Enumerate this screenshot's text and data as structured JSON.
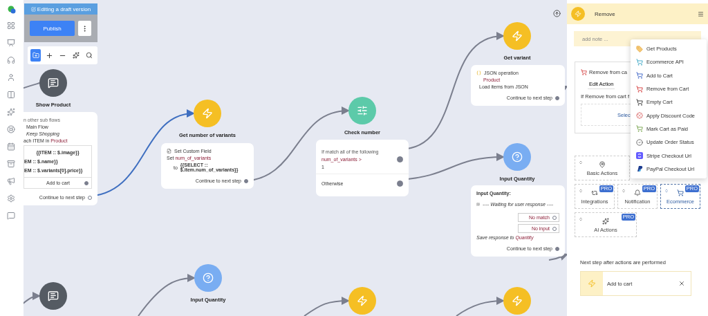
{
  "editor": {
    "banner": "Editing a draft version",
    "publish": "Publish"
  },
  "nodes": [
    {
      "kind": "message",
      "label": "Show Product",
      "card": [
        {
          "kind": "note",
          "text": "n other sub flows"
        },
        {
          "kind": "item",
          "text": "Main Flow"
        },
        {
          "kind": "item_italic",
          "text": "Keep Shopping"
        },
        {
          "kind": "field",
          "prefix": "ach ITEM in",
          "var": "Product"
        },
        {
          "kind": "gallery",
          "image": "{{ITEM :: $.image}}",
          "lines": [
            "EM :: $.name}}",
            "EM :: $.variants[0].price}}"
          ],
          "button": "Add to cart",
          "connected": true
        },
        {
          "kind": "continue",
          "text": "Continue to next step",
          "connected": false
        }
      ]
    },
    {
      "kind": "action",
      "label": "Get number of variants",
      "card": [
        {
          "kind": "custom_field",
          "text": "Set Custom Field"
        },
        {
          "kind": "field",
          "prefix": "Set",
          "var": "num_of_variants"
        },
        {
          "kind": "assign",
          "prefix": "to",
          "lines": [
            "{{SELECT ::",
            "$.item.num_of_variants}}"
          ]
        },
        {
          "kind": "continue",
          "text": "Continue to next step",
          "connected": true
        }
      ]
    },
    {
      "kind": "condition",
      "label": "Check number",
      "card": [
        {
          "kind": "condition",
          "note": "If match all of the following",
          "var": "num_of_variants >",
          "value": "1",
          "connected": true
        },
        {
          "kind": "otherwise",
          "text": "Otherwise",
          "connected": true
        }
      ]
    },
    {
      "kind": "action",
      "label": "Get variant",
      "card": [
        {
          "kind": "json_op",
          "text": "JSON operation"
        },
        {
          "kind": "var",
          "text": "Product"
        },
        {
          "kind": "item",
          "text": "Load items from JSON"
        },
        {
          "kind": "continue",
          "text": "Continue to next step",
          "connected": true
        }
      ]
    },
    {
      "kind": "question",
      "label": "Input Quantity",
      "card": [
        {
          "kind": "heading",
          "text": "Input Quantity:"
        },
        {
          "kind": "waiting",
          "text": "---- Waiting for user response ----"
        },
        {
          "kind": "reply",
          "text": "No match",
          "connected": false
        },
        {
          "kind": "reply",
          "text": "No input",
          "connected": false
        },
        {
          "kind": "save",
          "prefix": "Save response to",
          "var": "Quantity"
        },
        {
          "kind": "continue",
          "text": "Continue to next step",
          "connected": true
        }
      ]
    },
    {
      "kind": "message"
    },
    {
      "kind": "question",
      "label": "Input Quantity"
    },
    {
      "kind": "action"
    },
    {
      "kind": "action"
    }
  ],
  "panel": {
    "title": "Remove",
    "note_placeholder": "add note ...",
    "action": {
      "title": "Remove from ca",
      "button": "Edit Action",
      "condition": "If Remove from cart f",
      "select": "Selec"
    },
    "category_rows": [
      [
        {
          "label": "Basic Actions",
          "selected": false
        }
      ],
      [
        {
          "label": "Integrations",
          "badge": "PRO",
          "selected": false
        },
        {
          "label": "Notification",
          "badge": "PRO",
          "selected": false
        },
        {
          "label": "Ecommerce",
          "badge": "PRO",
          "selected": true
        }
      ],
      [
        {
          "label": "AI Actions",
          "badge": "PRO",
          "selected": false
        }
      ]
    ],
    "next_label": "Next step after actions are performed",
    "next_step": "Add to cart"
  },
  "menu": [
    "Get Products",
    "Ecommerce API",
    "Add to Cart",
    "Remove from Cart",
    "Empty Cart",
    "Apply Discount Code",
    "Mark Cart as Paid",
    "Update Order Status",
    "Stripe Checkout Url",
    "PayPal Checkout Url"
  ]
}
